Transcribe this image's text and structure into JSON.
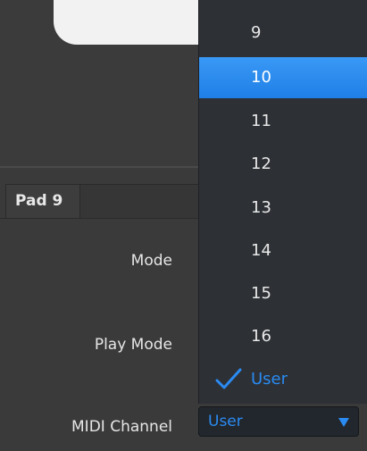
{
  "tab": {
    "label": "Pad 9"
  },
  "settings": {
    "mode_label": "Mode",
    "play_mode_label": "Play Mode",
    "midi_channel_label": "MIDI Channel",
    "midi_channel_value": "User"
  },
  "dropdown": {
    "items": [
      {
        "label": "9"
      },
      {
        "label": "10",
        "state": "highlighted"
      },
      {
        "label": "11"
      },
      {
        "label": "12"
      },
      {
        "label": "13"
      },
      {
        "label": "14"
      },
      {
        "label": "15"
      },
      {
        "label": "16"
      },
      {
        "label": "User",
        "state": "checked"
      }
    ]
  },
  "icons": {
    "check": "check-icon",
    "arrow": "chevron-down-icon"
  },
  "colors": {
    "accent": "#2a8bf2",
    "highlight": "#2b8cf0"
  }
}
